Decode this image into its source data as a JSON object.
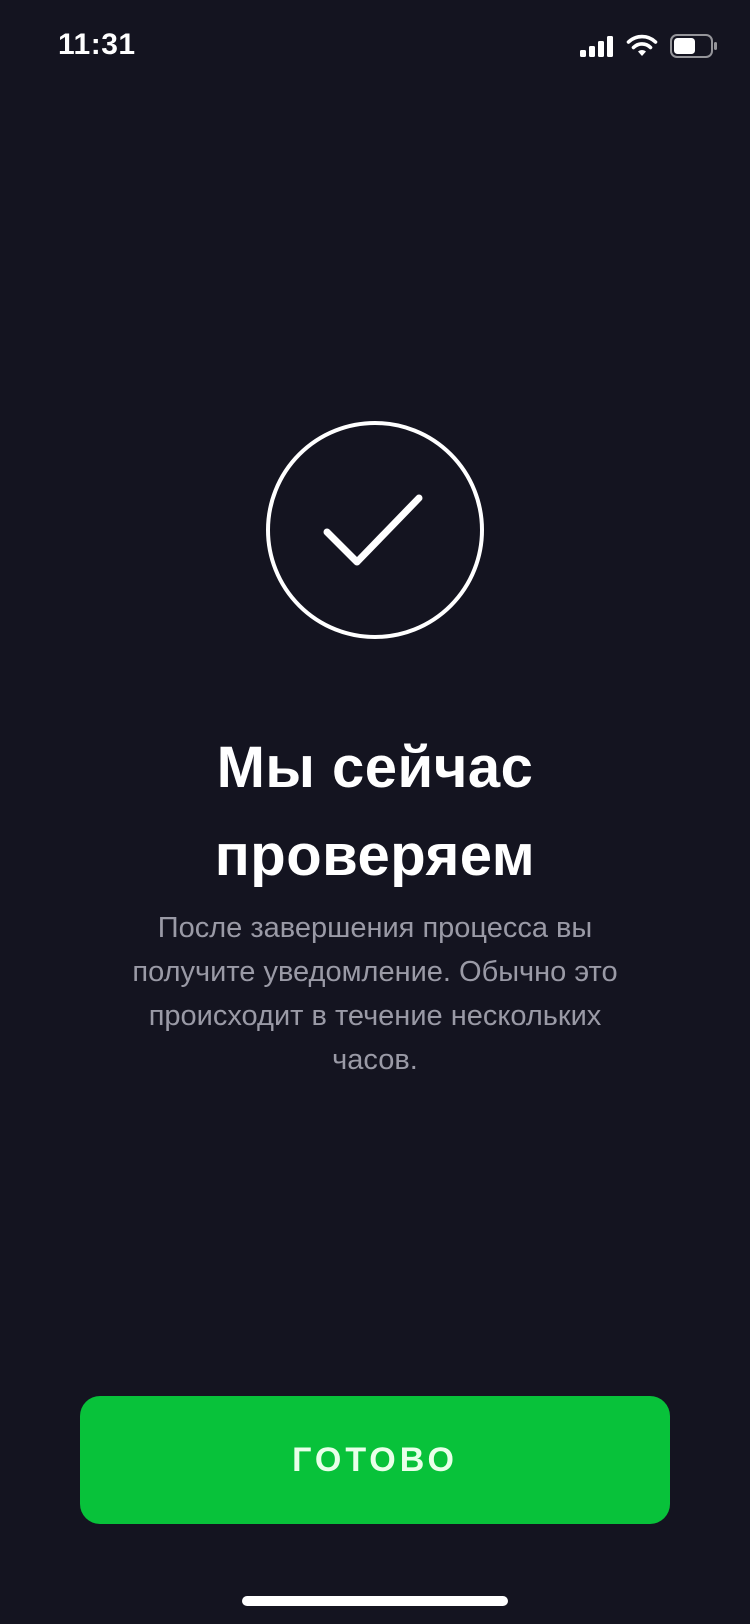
{
  "status_bar": {
    "time": "11:31",
    "signal_icon": "cellular-signal-icon",
    "wifi_icon": "wifi-icon",
    "battery_icon": "battery-icon",
    "battery_level": 0.6
  },
  "main": {
    "status_icon": "checkmark-circle-icon",
    "title_lines": [
      "Мы сейчас",
      "проверяем"
    ],
    "subtitle_lines": [
      "После завершения процесса вы",
      "получите уведомление. Обычно это",
      "происходит в течение нескольких",
      "часов."
    ]
  },
  "footer": {
    "done_label": "ГОТОВО"
  },
  "colors": {
    "background": "#141420",
    "accent_green": "#08c23a",
    "text_primary": "#ffffff",
    "text_secondary": "#9a9aa6"
  }
}
